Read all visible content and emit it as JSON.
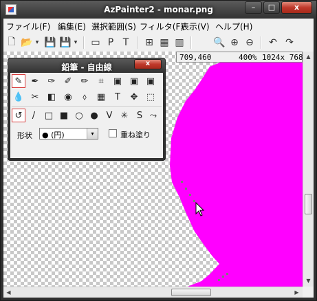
{
  "window": {
    "title": "AzPainter2 - monar.png",
    "buttons": {
      "minimize": "–",
      "maximize": "□",
      "close": "x"
    }
  },
  "menu": [
    {
      "label": "ファイル(F)"
    },
    {
      "label": "編集(E)"
    },
    {
      "label": "選択範囲(S)"
    },
    {
      "label": "フィルタ(F)"
    },
    {
      "label": "表示(V)"
    },
    {
      "label": "ヘルプ(H)"
    }
  ],
  "toolbar": {
    "new": "🗋",
    "open": "📂",
    "dropdown": "▾",
    "save": "💾",
    "saveas": "💾",
    "frame1": "▭",
    "frame2": "P",
    "frame3": "T",
    "grid1": "⊞",
    "grid2": "▦",
    "grid3": "▥",
    "zoom": "🔍",
    "zoomin": "⊕",
    "zoomout": "⊖",
    "undo": "↶",
    "redo": "↷"
  },
  "status": {
    "coords": "709,460",
    "zoom": "400%",
    "size": "1024x 768"
  },
  "colors": {
    "magenta": "#ff00ff",
    "accent_close": "#c0392b",
    "selected_border": "#d83a3a"
  },
  "palette": {
    "title": "鉛筆 - 自由線",
    "close_label": "x",
    "tools_row1": [
      "✎",
      "✒",
      "✑",
      "✐",
      "✏",
      "⌗",
      "▣",
      "▣",
      "▣"
    ],
    "tools_row2": [
      "💧",
      "✂",
      "◧",
      "◉",
      "⬨",
      "▦",
      "T",
      "✥",
      "⬚"
    ],
    "shapes": [
      "↺",
      "/",
      "□",
      "■",
      "○",
      "●",
      "V",
      "✳",
      "S",
      "⤳"
    ],
    "shape_label": "形状",
    "shape_value": "● (円)",
    "shape_arrow": "▾",
    "overpaint_label": "重ね塗り",
    "overpaint_checked": false
  },
  "scroll": {
    "up": "▲",
    "down": "▼",
    "left": "◀",
    "right": "▶"
  }
}
